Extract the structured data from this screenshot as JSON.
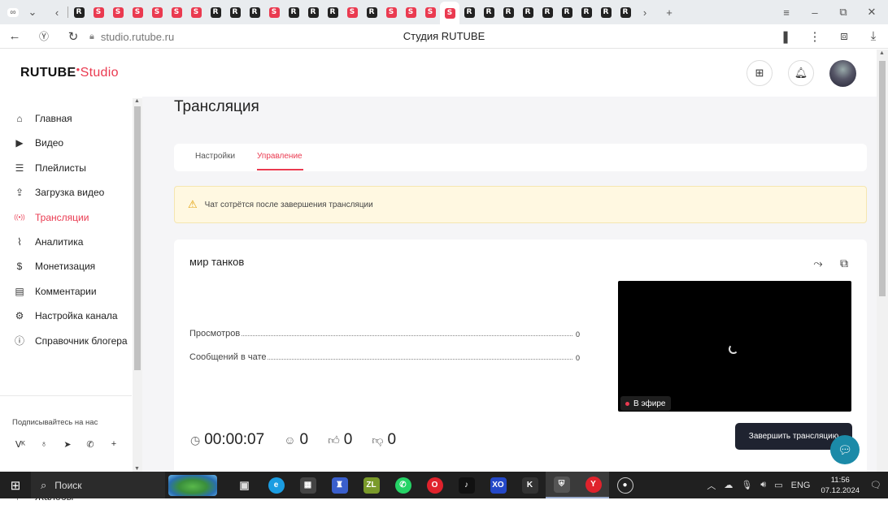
{
  "browser": {
    "page_title": "Студия RUTUBE",
    "url": "studio.rutube.ru",
    "tab_glyphs": [
      "R",
      "S",
      "S",
      "S",
      "S",
      "S",
      "S",
      "R",
      "R",
      "R",
      "S",
      "R",
      "R",
      "R",
      "S",
      "R",
      "S",
      "S",
      "S",
      "S",
      "R",
      "R",
      "R",
      "R",
      "R",
      "R",
      "R",
      "R",
      "R"
    ],
    "active_tab_index": 19
  },
  "app": {
    "logo_main": "RUTUBE",
    "logo_sub": "Studio",
    "sidebar": {
      "items": [
        {
          "label": "Главная",
          "icon": "home-icon"
        },
        {
          "label": "Видео",
          "icon": "video-icon"
        },
        {
          "label": "Плейлисты",
          "icon": "playlist-icon"
        },
        {
          "label": "Загрузка видео",
          "icon": "upload-icon"
        },
        {
          "label": "Трансляции",
          "icon": "broadcast-icon"
        },
        {
          "label": "Аналитика",
          "icon": "analytics-icon"
        },
        {
          "label": "Монетизация",
          "icon": "monetization-icon"
        },
        {
          "label": "Комментарии",
          "icon": "comments-icon"
        },
        {
          "label": "Настройка канала",
          "icon": "settings-icon"
        },
        {
          "label": "Справочник блогера",
          "icon": "info-icon"
        }
      ],
      "active_index": 4,
      "subscribe_label": "Подписывайтесь на нас",
      "socials": [
        "vk-icon",
        "ok-icon",
        "telegram-icon",
        "viber-icon",
        "plus-icon"
      ],
      "complaints_label": "Жалобы"
    },
    "page_title": "Трансляция",
    "tabs": [
      {
        "label": "Настройки"
      },
      {
        "label": "Управление"
      }
    ],
    "active_tab": 1,
    "notice": "Чат сотрётся после завершения трансляции",
    "stream": {
      "name": "мир танков",
      "stats": [
        {
          "label": "Просмотров",
          "value": "0"
        },
        {
          "label": "Сообщений в чате",
          "value": "0"
        }
      ],
      "live_label": "В эфире",
      "duration": "00:00:07",
      "viewers": "0",
      "likes": "0",
      "dislikes": "0",
      "end_button": "Завершить трансляцию"
    },
    "accent_color": "#ea3a50"
  },
  "taskbar": {
    "search_label": "Поиск",
    "lang": "ENG",
    "time": "11:56",
    "date": "07.12.2024"
  }
}
